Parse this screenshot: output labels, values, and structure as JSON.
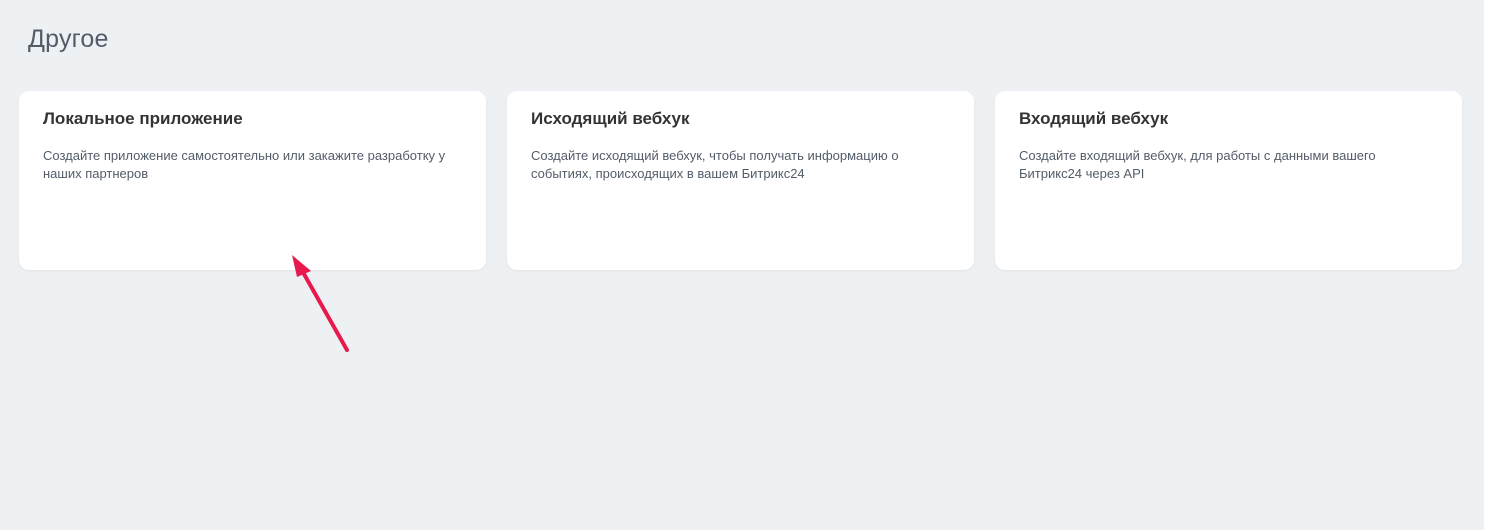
{
  "section": {
    "title": "Другое"
  },
  "cards": [
    {
      "title": "Локальное приложение",
      "description": "Создайте приложение самостоятельно или закажите разработку у наших партнеров"
    },
    {
      "title": "Исходящий вебхук",
      "description": "Создайте исходящий вебхук, чтобы получать информацию о событиях, происходящих в вашем Битрикс24"
    },
    {
      "title": "Входящий вебхук",
      "description": "Создайте входящий вебхук, для работы с данными вашего Битрикс24 через API"
    }
  ],
  "annotation": {
    "arrow_color": "#e8194f",
    "icon": "arrow-up-left-icon"
  },
  "colors": {
    "background": "#eef1f4",
    "card_background": "#ffffff",
    "title_text": "#333333",
    "secondary_text": "#535c69"
  }
}
